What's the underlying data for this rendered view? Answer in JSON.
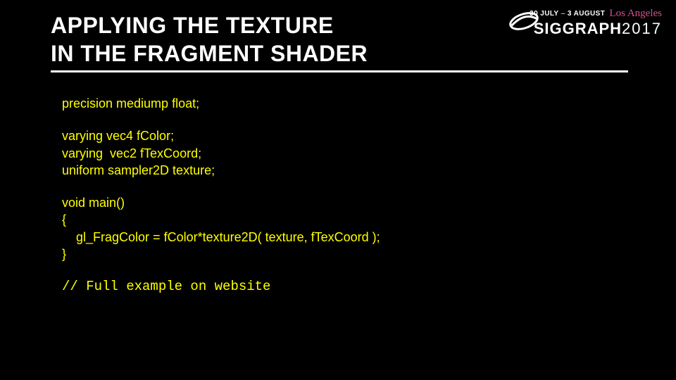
{
  "title_line1": "APPLYING THE TEXTURE",
  "title_line2": "IN THE FRAGMENT SHADER",
  "badge": {
    "dates_prefix": "30 JULY",
    "dates_sep": "–",
    "dates_suffix": "3 AUGUST",
    "city": "Los Angeles",
    "brand": "SIGGRAPH",
    "year": "2017"
  },
  "code": {
    "l1": "precision mediump float;",
    "l2": "varying vec4 fColor;",
    "l3": "varying  vec2 fTexCoord;",
    "l4": "uniform sampler2D texture;",
    "l5": "void main()",
    "l6": "{",
    "l7": "    gl_FragColor = fColor*texture2D( texture, fTexCoord );",
    "l8": "}",
    "l9": "// Full example on website"
  }
}
